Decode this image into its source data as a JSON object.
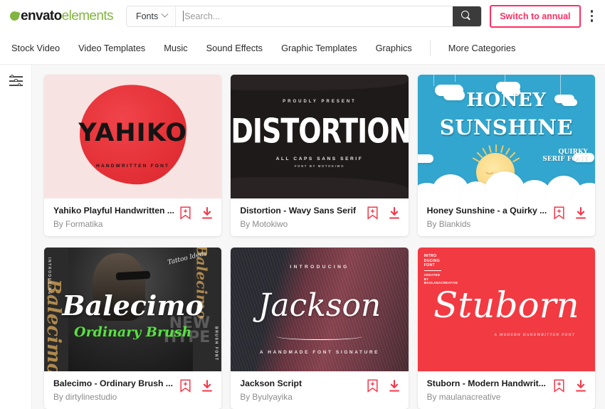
{
  "header": {
    "logo": {
      "brand": "envato",
      "suffix": "elements",
      "leaf_icon": "leaf-icon"
    },
    "category_select": {
      "value": "Fonts",
      "chevron_icon": "chevron-down-icon"
    },
    "search": {
      "value": "",
      "placeholder": "Search...",
      "button_icon": "search-icon"
    },
    "switch_annual_label": "Switch to annual",
    "switch_annual_color": "#ff2e63",
    "kebab_icon": "more-vertical-icon"
  },
  "nav": {
    "items": [
      {
        "label": "Stock Video"
      },
      {
        "label": "Video Templates"
      },
      {
        "label": "Music"
      },
      {
        "label": "Sound Effects"
      },
      {
        "label": "Graphic Templates"
      },
      {
        "label": "Graphics"
      }
    ],
    "more": {
      "label": "More Categories"
    }
  },
  "sidebar": {
    "filter_icon": "filter-sliders-icon"
  },
  "actions": {
    "bookmark_icon": "bookmark-add-icon",
    "download_icon": "download-icon",
    "accent_color": "#f4374a"
  },
  "cards": [
    {
      "title": "Yahiko Playful Handwritten ...",
      "author": "By Formatika",
      "art": {
        "style": "yahiko",
        "title": "YAHIKO",
        "subtitle": "HANDWRITTEN FONT",
        "bg_color": "#f7e3e1",
        "accent_color": "#e02027"
      }
    },
    {
      "title": "Distortion - Wavy Sans Serif",
      "author": "By Motokiwo",
      "art": {
        "style": "distortion",
        "eyebrow": "PROUDLY PRESENT",
        "title": "DISTORTION",
        "subtitle": "ALL CAPS SANS SERIF",
        "subtitle2": "FONT BY MOTOKIWO",
        "bg_color": "#1f1a1a"
      }
    },
    {
      "title": "Honey Sunshine - a Quirky ...",
      "author": "By Blankids",
      "art": {
        "style": "honey",
        "line1": "HONEY",
        "line2": "SUNSHINE",
        "sub_line1": "QUIRKY",
        "sub_line2": "SERIF FONT",
        "bg_color": "#32a6cf"
      }
    },
    {
      "title": "Balecimo - Ordinary Brush ...",
      "author": "By dirtylinestudio",
      "art": {
        "style": "balecimo",
        "title": "Balecimo",
        "subtitle": "Ordinary Brush",
        "overlay1": "NEW",
        "overlay2": "HYPE",
        "vertical_left": "INTRODUCING",
        "vertical_right": "BRUSH FONT",
        "gold_left": "Balecimo",
        "gold_right": "Balecimo",
        "script_small": "Tattoo Ideas",
        "accent_color": "#56e23f"
      }
    },
    {
      "title": "Jackson Script",
      "author": "By Byulyayika",
      "art": {
        "style": "jackson",
        "eyebrow": "INTRODUCING",
        "title": "Jackson",
        "subtitle": "A HANDMADE FONT SIGNATURE"
      }
    },
    {
      "title": "Stuborn - Modern Handwrit...",
      "author": "By maulanacreative",
      "art": {
        "style": "stuborn",
        "corner_line1": "INTRO",
        "corner_line2": "DUCING",
        "corner_line3": "FONT",
        "corner_line4": "CREATED",
        "corner_line5": "BY",
        "corner_line6": "MAULANACREATIVE",
        "title": "Stuborn",
        "subtitle": "A MODERN HANDWRITTEN FONT",
        "bg_color": "#f23a42"
      }
    }
  ]
}
